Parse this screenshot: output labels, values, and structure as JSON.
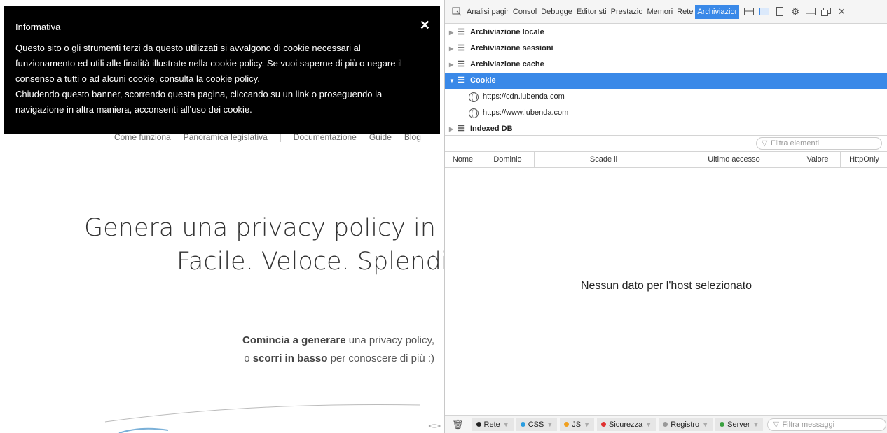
{
  "banner": {
    "title": "Informativa",
    "close": "✕",
    "line1": "Questo sito o gli strumenti terzi da questo utilizzati si avvalgono di cookie necessari al",
    "line2": "funzionamento ed utili alle finalità illustrate nella cookie policy. Se vuoi saperne di più o negare il",
    "line3_pre": "consenso a tutti o ad alcuni cookie, consulta la ",
    "line3_link": "cookie policy",
    "line3_post": ".",
    "line4": "Chiudendo questo banner, scorrendo questa pagina, cliccando su un link o proseguendo la",
    "line5": "navigazione in altra maniera, acconsenti all'uso dei cookie."
  },
  "site": {
    "nav": [
      "Come funziona",
      "Panoramica legislativa",
      "Documentazione",
      "Guide",
      "Blog"
    ],
    "hero_line1": "Genera una privacy policy in p",
    "hero_line2": "Facile. Veloce. Splendi",
    "sub_b1": "Comincia a generare",
    "sub_t1": " una privacy policy,",
    "sub_t2": "o ",
    "sub_b2": "scorri in basso",
    "sub_t3": " per conoscere di più :)"
  },
  "devtools": {
    "tabs": [
      "Analisi pagir",
      "Consol",
      "Debugge",
      "Editor sti",
      "Prestazio",
      "Memori",
      "Rete",
      "Archiviazior"
    ],
    "active_tab": "Archiviazior",
    "tree": {
      "local": "Archiviazione locale",
      "session": "Archiviazione sessioni",
      "cache": "Archiviazione cache",
      "cookie": "Cookie",
      "host1": "https://cdn.iubenda.com",
      "host2": "https://www.iubenda.com",
      "idb": "Indexed DB"
    },
    "filter_placeholder": "Filtra elementi",
    "columns": [
      "Nome",
      "Dominio",
      "Scade il",
      "Ultimo accesso",
      "Valore",
      "HttpOnly"
    ],
    "empty_message": "Nessun dato per l'host selezionato",
    "console": {
      "tags": [
        {
          "label": "Rete",
          "color": "#222222"
        },
        {
          "label": "CSS",
          "color": "#2a9de0"
        },
        {
          "label": "JS",
          "color": "#f0a020"
        },
        {
          "label": "Sicurezza",
          "color": "#e03030"
        },
        {
          "label": "Registro",
          "color": "#999999"
        },
        {
          "label": "Server",
          "color": "#3aa040"
        }
      ],
      "filter_placeholder": "Filtra messaggi"
    }
  },
  "colors": {
    "accent": "#3a89e8"
  }
}
